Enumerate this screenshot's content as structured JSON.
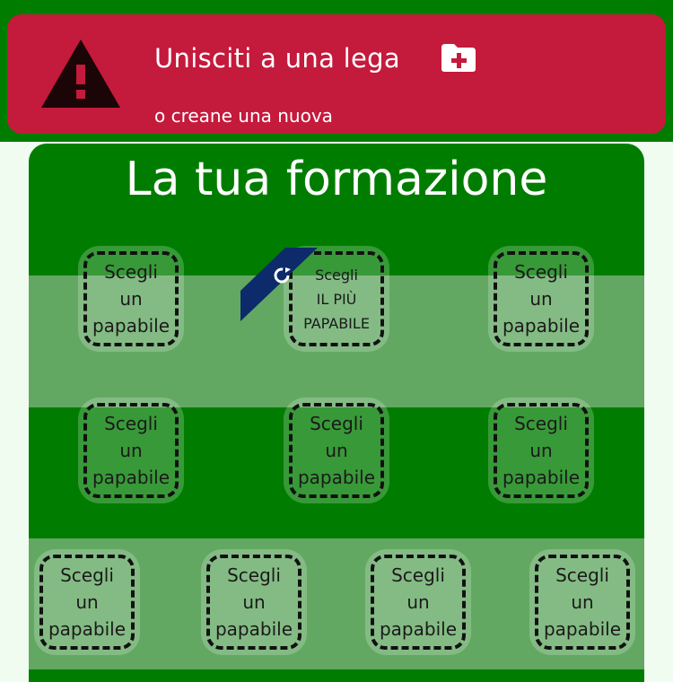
{
  "alert": {
    "title": "Unisciti a una lega",
    "subtitle": "o creane una nuova",
    "warning_icon": "warning-triangle-icon",
    "folder_icon": "folder-plus-icon"
  },
  "formation": {
    "heading": "La tua formazione",
    "slot_lines": [
      "Scegli",
      "un",
      "papabile"
    ],
    "captain_lines": [
      "Scegli",
      "IL PIÙ",
      "PAPABILE"
    ],
    "captain_icon": "refresh-icon"
  },
  "colors": {
    "field_green": "#007d00",
    "stripe_green": "#62a862",
    "alert_red": "#c41a3c",
    "ribbon_blue": "#0d2a6b",
    "page_bg": "#f1fcf1"
  }
}
